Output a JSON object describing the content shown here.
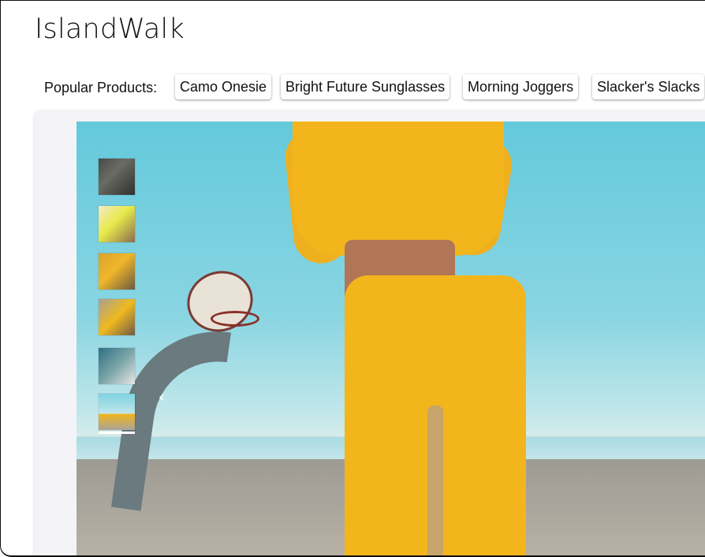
{
  "header": {
    "brand": "IslandWalk"
  },
  "popular": {
    "label": "Popular Products:",
    "items": [
      {
        "label": "Camo Onesie"
      },
      {
        "label": "Bright Future Sunglasses"
      },
      {
        "label": "Morning Joggers"
      },
      {
        "label": "Slacker's Slacks"
      }
    ]
  },
  "gallery": {
    "thumbnail_count": 6,
    "selected_thumbnail": 6,
    "previous_icon": "chevron-left-icon",
    "chevron_glyph": "‹"
  }
}
